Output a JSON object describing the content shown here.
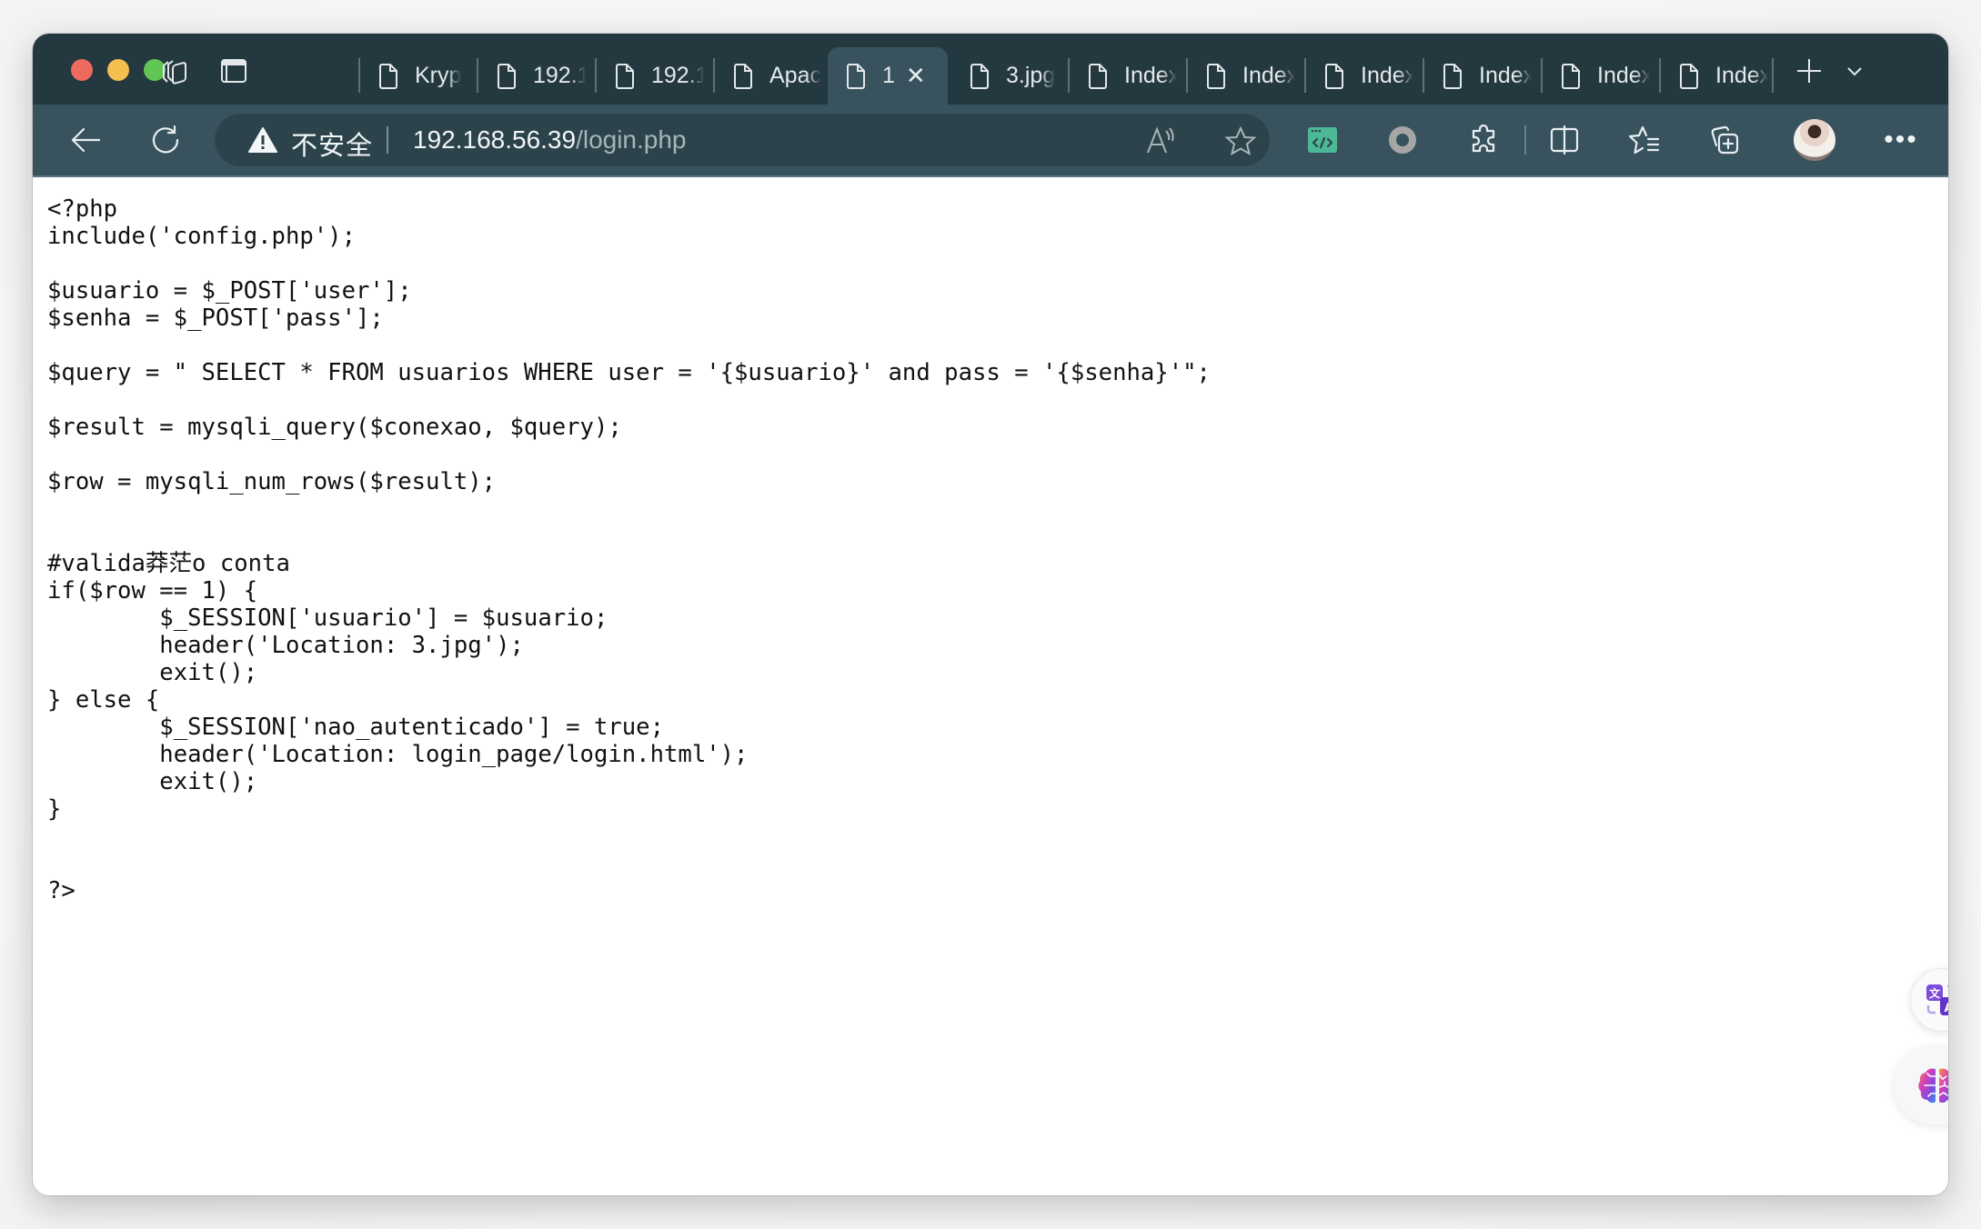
{
  "window": {
    "traffic_lights": [
      "close",
      "minimize",
      "zoom"
    ]
  },
  "tabstrip": {
    "left_icons": [
      "workspaces-icon",
      "vertical-tabs-icon"
    ],
    "tabs": [
      {
        "label": "Kryp",
        "icon": "page-icon",
        "active": false
      },
      {
        "label": "192.1",
        "icon": "page-icon",
        "active": false
      },
      {
        "label": "192.1",
        "icon": "page-icon",
        "active": false
      },
      {
        "label": "Apac",
        "icon": "page-icon",
        "active": false
      },
      {
        "label": "1",
        "icon": "page-icon",
        "active": true,
        "close": "✕"
      },
      {
        "label": "3.jpg",
        "icon": "page-icon",
        "active": false
      },
      {
        "label": "Index",
        "icon": "page-icon",
        "active": false
      },
      {
        "label": "Index",
        "icon": "page-icon",
        "active": false
      },
      {
        "label": "Index",
        "icon": "page-icon",
        "active": false
      },
      {
        "label": "Index",
        "icon": "page-icon",
        "active": false
      },
      {
        "label": "Index",
        "icon": "page-icon",
        "active": false
      },
      {
        "label": "Index",
        "icon": "page-icon",
        "active": false
      }
    ],
    "new_tab": "+",
    "tab_menu": "⌄"
  },
  "toolbar": {
    "security_label": "不安全",
    "url_host": "192.168.56.39",
    "url_path": "/login.php",
    "more": "•••",
    "colors": {
      "tabstrip_bg": "#243840",
      "toolbar_bg": "#38535e",
      "address_bg": "#2c434c",
      "devtools_ext": "#4db896"
    }
  },
  "page": {
    "source_code": "<?php\ninclude('config.php');\n\n$usuario = $_POST['user'];\n$senha = $_POST['pass'];\n\n$query = \" SELECT * FROM usuarios WHERE user = '{$usuario}' and pass = '{$senha}'\";\n\n$result = mysqli_query($conexao, $query);\n\n$row = mysqli_num_rows($result);\n\n\n#valida莽茫o conta\nif($row == 1) {\n\t$_SESSION['usuario'] = $usuario;\n\theader('Location: 3.jpg');\n\texit();\n} else {\n\t$_SESSION['nao_autenticado'] = true;\n\theader('Location: login_page/login.html');\n\texit();\n}\n\n\n?>"
  },
  "floating": {
    "translate": "translate-icon",
    "ai": "brain-icon"
  }
}
